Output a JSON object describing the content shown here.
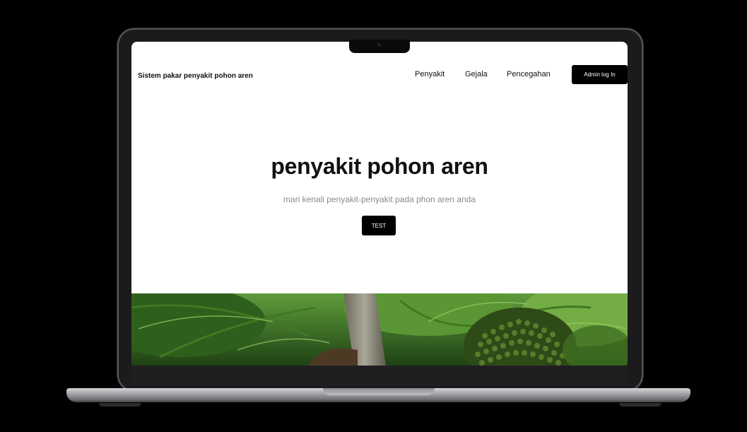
{
  "site": {
    "brand": "Sistem pakar penyakit pohon aren"
  },
  "nav": {
    "links": [
      "Penyakit",
      "Gejala",
      "Pencegahan"
    ],
    "admin_button": "Admin log In"
  },
  "hero": {
    "title": "penyakit pohon aren",
    "subtitle": "mari kenali penyakit-penyakit pada phon aren anda",
    "cta_button": "TEST"
  },
  "banner": {
    "image_icon": "palm-tree-photo"
  },
  "colors": {
    "background": "#000000",
    "button": "#000000",
    "button_text": "#ffffff",
    "foliage": "#3f7a22"
  }
}
